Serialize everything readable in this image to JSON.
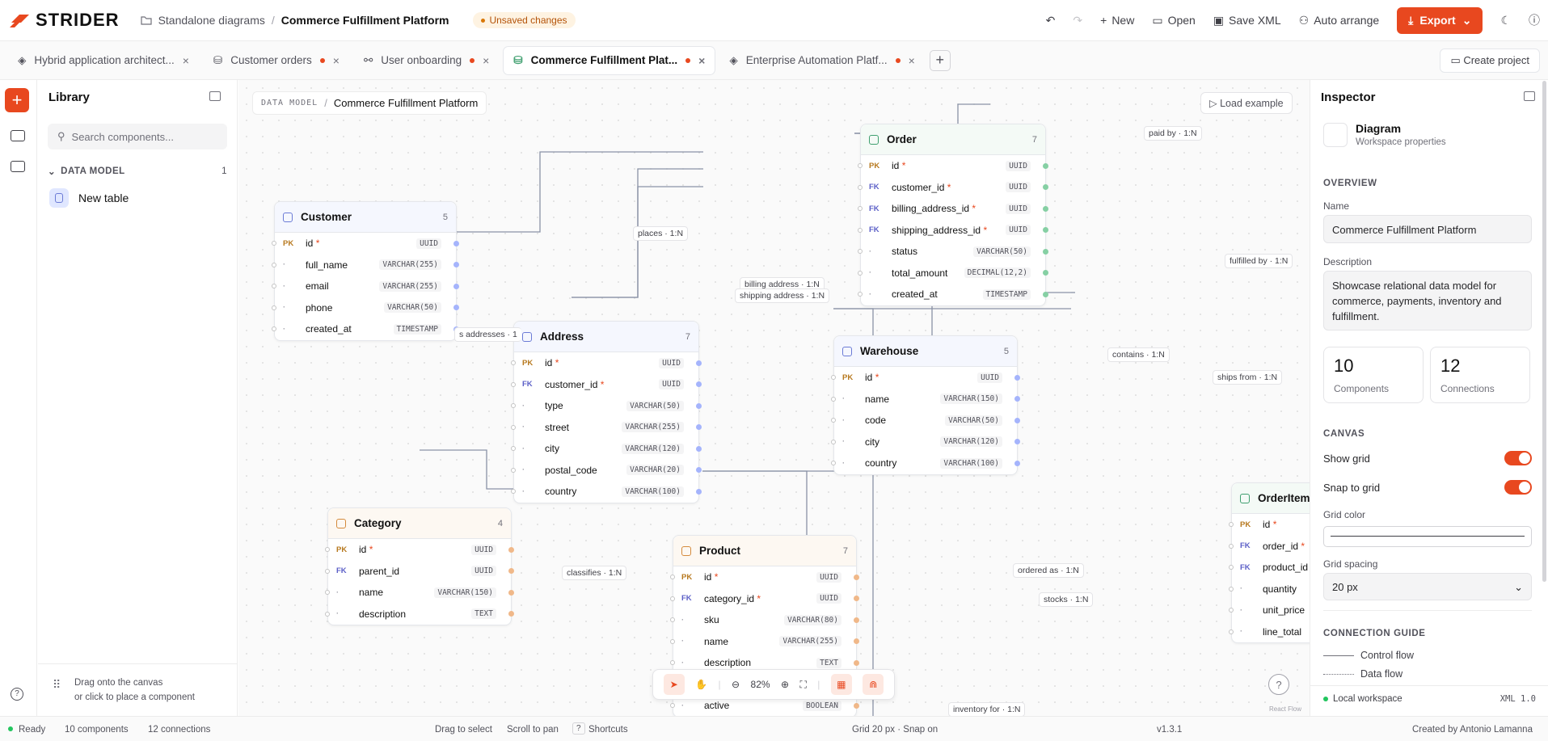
{
  "header": {
    "brand": "STRIDER",
    "breadcrumb_root": "Standalone diagrams",
    "breadcrumb_current": "Commerce Fulfillment Platform",
    "status_badge": "Unsaved changes",
    "new_label": "New",
    "open_label": "Open",
    "save_label": "Save XML",
    "auto_arrange_label": "Auto arrange",
    "export_label": "Export"
  },
  "tabs": [
    {
      "label": "Hybrid application architect..."
    },
    {
      "label": "Customer orders"
    },
    {
      "label": "User onboarding"
    },
    {
      "label": "Commerce Fulfillment Plat..."
    },
    {
      "label": "Enterprise Automation Platf..."
    }
  ],
  "create_project_label": "Create project",
  "library": {
    "title": "Library",
    "search_placeholder": "Search components...",
    "section": "DATA MODEL",
    "section_count": "1",
    "item": "New table",
    "hint_line1": "Drag onto the canvas",
    "hint_line2": "or click to place a component"
  },
  "canvas": {
    "crumb_kind": "DATA MODEL",
    "crumb_name": "Commerce Fulfillment Platform",
    "load_example": "Load example",
    "zoom": "82%",
    "react_flow": "React Flow"
  },
  "tables": {
    "order": {
      "name": "Order",
      "count": "7",
      "rows": [
        {
          "key": "PK",
          "name": "id",
          "req": "*",
          "type": "UUID"
        },
        {
          "key": "FK",
          "name": "customer_id",
          "req": "*",
          "type": "UUID"
        },
        {
          "key": "FK",
          "name": "billing_address_id",
          "req": "*",
          "type": "UUID"
        },
        {
          "key": "FK",
          "name": "shipping_address_id",
          "req": "*",
          "type": "UUID"
        },
        {
          "key": "·",
          "name": "status",
          "req": "",
          "type": "VARCHAR(50)"
        },
        {
          "key": "·",
          "name": "total_amount",
          "req": "",
          "type": "DECIMAL(12,2)"
        },
        {
          "key": "·",
          "name": "created_at",
          "req": "",
          "type": "TIMESTAMP"
        }
      ]
    },
    "customer": {
      "name": "Customer",
      "count": "5",
      "rows": [
        {
          "key": "PK",
          "name": "id",
          "req": "*",
          "type": "UUID"
        },
        {
          "key": "·",
          "name": "full_name",
          "req": "",
          "type": "VARCHAR(255)"
        },
        {
          "key": "·",
          "name": "email",
          "req": "",
          "type": "VARCHAR(255)"
        },
        {
          "key": "·",
          "name": "phone",
          "req": "",
          "type": "VARCHAR(50)"
        },
        {
          "key": "·",
          "name": "created_at",
          "req": "",
          "type": "TIMESTAMP"
        }
      ]
    },
    "address": {
      "name": "Address",
      "count": "7",
      "rows": [
        {
          "key": "PK",
          "name": "id",
          "req": "*",
          "type": "UUID"
        },
        {
          "key": "FK",
          "name": "customer_id",
          "req": "*",
          "type": "UUID"
        },
        {
          "key": "·",
          "name": "type",
          "req": "",
          "type": "VARCHAR(50)"
        },
        {
          "key": "·",
          "name": "street",
          "req": "",
          "type": "VARCHAR(255)"
        },
        {
          "key": "·",
          "name": "city",
          "req": "",
          "type": "VARCHAR(120)"
        },
        {
          "key": "·",
          "name": "postal_code",
          "req": "",
          "type": "VARCHAR(20)"
        },
        {
          "key": "·",
          "name": "country",
          "req": "",
          "type": "VARCHAR(100)"
        }
      ]
    },
    "warehouse": {
      "name": "Warehouse",
      "count": "5",
      "rows": [
        {
          "key": "PK",
          "name": "id",
          "req": "*",
          "type": "UUID"
        },
        {
          "key": "·",
          "name": "name",
          "req": "",
          "type": "VARCHAR(150)"
        },
        {
          "key": "·",
          "name": "code",
          "req": "",
          "type": "VARCHAR(50)"
        },
        {
          "key": "·",
          "name": "city",
          "req": "",
          "type": "VARCHAR(120)"
        },
        {
          "key": "·",
          "name": "country",
          "req": "",
          "type": "VARCHAR(100)"
        }
      ]
    },
    "category": {
      "name": "Category",
      "count": "4",
      "rows": [
        {
          "key": "PK",
          "name": "id",
          "req": "*",
          "type": "UUID"
        },
        {
          "key": "FK",
          "name": "parent_id",
          "req": "",
          "type": "UUID"
        },
        {
          "key": "·",
          "name": "name",
          "req": "",
          "type": "VARCHAR(150)"
        },
        {
          "key": "·",
          "name": "description",
          "req": "",
          "type": "TEXT"
        }
      ]
    },
    "product": {
      "name": "Product",
      "count": "7",
      "rows": [
        {
          "key": "PK",
          "name": "id",
          "req": "*",
          "type": "UUID"
        },
        {
          "key": "FK",
          "name": "category_id",
          "req": "*",
          "type": "UUID"
        },
        {
          "key": "·",
          "name": "sku",
          "req": "",
          "type": "VARCHAR(80)"
        },
        {
          "key": "·",
          "name": "name",
          "req": "",
          "type": "VARCHAR(255)"
        },
        {
          "key": "·",
          "name": "description",
          "req": "",
          "type": "TEXT"
        },
        {
          "key": "·",
          "name": "",
          "req": "",
          "type": ""
        },
        {
          "key": "·",
          "name": "active",
          "req": "",
          "type": "BOOLEAN"
        }
      ]
    },
    "orderitem": {
      "name": "OrderItem",
      "count": "",
      "rows": [
        {
          "key": "PK",
          "name": "id",
          "req": "*",
          "type": ""
        },
        {
          "key": "FK",
          "name": "order_id",
          "req": "*",
          "type": ""
        },
        {
          "key": "FK",
          "name": "product_id",
          "req": "*",
          "type": ""
        },
        {
          "key": "·",
          "name": "quantity",
          "req": "",
          "type": ""
        },
        {
          "key": "·",
          "name": "unit_price",
          "req": "",
          "type": ""
        },
        {
          "key": "·",
          "name": "line_total",
          "req": "",
          "type": ""
        }
      ]
    }
  },
  "edge_labels": {
    "places": "places · 1:N",
    "paid_by": "paid by · 1:N",
    "fulfilled_by": "fulfilled by · 1:N",
    "billing": "billing address · 1:N",
    "shipping": "shipping address · 1:N",
    "has_addresses": "s addresses · 1",
    "contains": "contains · 1:N",
    "ships_from": "ships from · 1:N",
    "classifies": "classifies · 1:N",
    "ordered_as": "ordered as · 1:N",
    "stocks": "stocks · 1:N",
    "inventory_for": "inventory for · 1:N"
  },
  "inspector": {
    "title": "Inspector",
    "subject": "Diagram",
    "subject_sub": "Workspace properties",
    "overview": "OVERVIEW",
    "name_label": "Name",
    "name_value": "Commerce Fulfillment Platform",
    "desc_label": "Description",
    "desc_value": "Showcase relational data model for commerce, payments, inventory and fulfillment.",
    "components_value": "10",
    "components_label": "Components",
    "connections_value": "12",
    "connections_label": "Connections",
    "canvas_section": "CANVAS",
    "show_grid": "Show grid",
    "snap_grid": "Snap to grid",
    "grid_color": "Grid color",
    "grid_spacing": "Grid spacing",
    "grid_spacing_value": "20 px",
    "guide_section": "CONNECTION GUIDE",
    "control_flow": "Control flow",
    "data_flow": "Data flow",
    "workspace": "Local workspace",
    "xml_version": "XML 1.0"
  },
  "status": {
    "ready": "Ready",
    "components": "10 components",
    "connections": "12 connections",
    "drag": "Drag to select",
    "scroll": "Scroll to pan",
    "shortcuts": "Shortcuts",
    "grid": "Grid 20 px · Snap on",
    "version": "v1.3.1",
    "author": "Created by  Antonio Lamanna"
  },
  "colors": {
    "accent": "#e8481f",
    "blue": "#6b7bd6",
    "green": "#3f9f6f",
    "orange": "#d48a3c"
  }
}
